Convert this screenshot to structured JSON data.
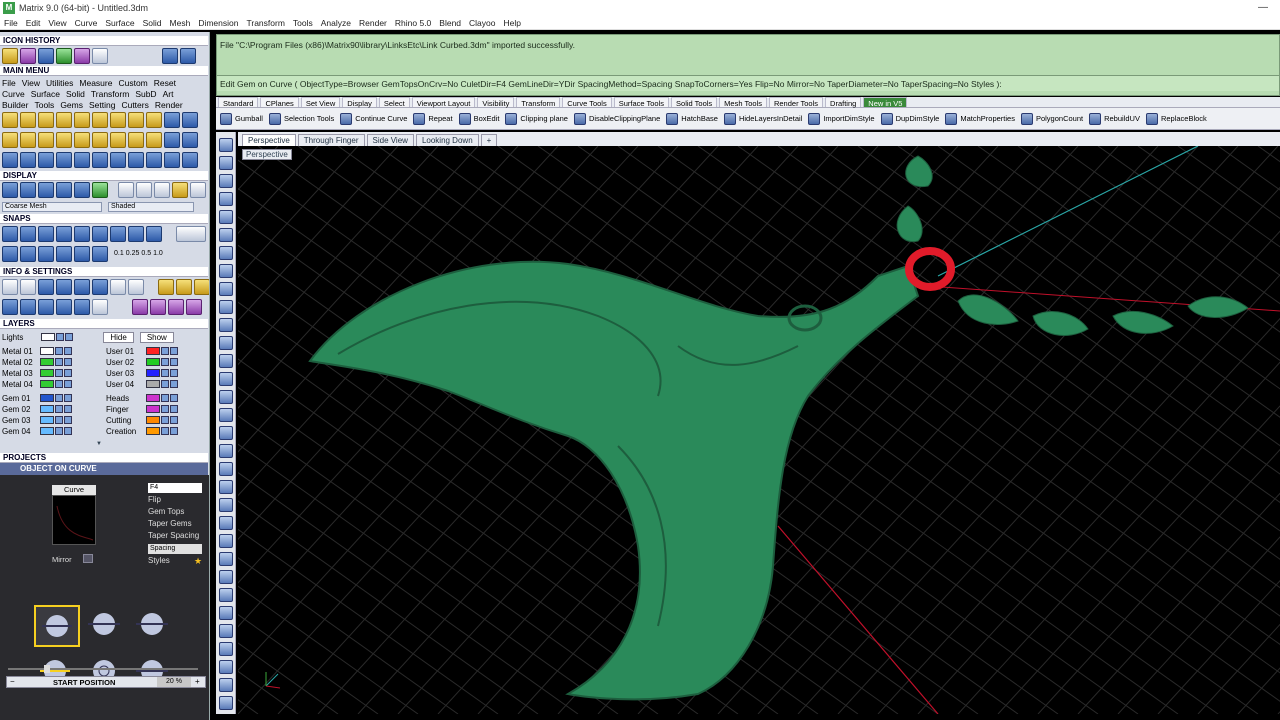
{
  "window": {
    "title": "Matrix 9.0 (64-bit) - Untitled.3dm",
    "logo": "M"
  },
  "menubar": [
    "File",
    "Edit",
    "View",
    "Curve",
    "Surface",
    "Solid",
    "Mesh",
    "Dimension",
    "Transform",
    "Tools",
    "Analyze",
    "Render",
    "Rhino 5.0",
    "Blend",
    "Clayoo",
    "Help"
  ],
  "left": {
    "icon_history": "ICON HISTORY",
    "main_menu": "MAIN MENU",
    "mm_row1": [
      "File",
      "View",
      "Utilities",
      "Measure",
      "Custom",
      "Reset"
    ],
    "mm_row2": [
      "Curve",
      "Surface",
      "Solid",
      "Transform",
      "SubD",
      "Art"
    ],
    "mm_row3": [
      "Builder",
      "Tools",
      "Gems",
      "Setting",
      "Cutters",
      "Render"
    ],
    "display": "DISPLAY",
    "display_sel1": "Coarse Mesh",
    "display_sel2": "Shaded",
    "snaps": "SNAPS",
    "snap_values": [
      "0.1",
      "0.25",
      "0.5",
      "1.0"
    ],
    "info": "INFO & SETTINGS",
    "layers": "LAYERS",
    "layers_lights": "Lights",
    "layers_hide": "Hide",
    "layers_show": "Show",
    "layer_left": [
      "Metal 01",
      "Metal 02",
      "Metal 03",
      "Metal 04",
      "",
      "Gem 01",
      "Gem 02",
      "Gem 03",
      "Gem 04"
    ],
    "layer_right": [
      "User 01",
      "User 02",
      "User 03",
      "User 04",
      "",
      "Heads",
      "Finger",
      "Cutting",
      "Creation"
    ],
    "layer_colors_left": [
      "#ffffff",
      "#33cc33",
      "#33cc33",
      "#33cc33",
      "",
      "#2255cc",
      "#66bbff",
      "#66bbff",
      "#66bbff"
    ],
    "layer_colors_right": [
      "#ff2222",
      "#22cc22",
      "#2222ff",
      "#aaaaaa",
      "",
      "#cc33cc",
      "#cc33cc",
      "#ff8800",
      "#ff9900"
    ],
    "projects": "PROJECTS",
    "object_on_curve": "OBJECT ON CURVE",
    "curve_label": "Curve",
    "mirror_label": "Mirror",
    "props": [
      "F4",
      "Flip",
      "Gem Tops",
      "Taper Gems",
      "Taper Spacing",
      "Spacing",
      "Styles"
    ],
    "start_position": "START POSITION",
    "start_value": "20 %"
  },
  "console": {
    "line1": "File \"C:\\Program Files (x86)\\Matrix90\\library\\LinksEtc\\Link Curbed.3dm\" imported successfully.",
    "prompt": "Edit Gem on Curve ( ObjectType=Browser  GemTopsOnCrv=No  CuletDir=F4  GemLineDir=YDir  SpacingMethod=Spacing  SnapToCorners=Yes  Flip=No  Mirror=No  TaperDiameter=No  TaperSpacing=No  Styles ):"
  },
  "tabs": [
    "Standard",
    "CPlanes",
    "Set View",
    "Display",
    "Select",
    "Viewport Layout",
    "Visibility",
    "Transform",
    "Curve Tools",
    "Surface Tools",
    "Solid Tools",
    "Mesh Tools",
    "Render Tools",
    "Drafting",
    "New in V5"
  ],
  "active_tab": 14,
  "toolbar": [
    "Gumball",
    "Selection Tools",
    "Continue Curve",
    "Repeat",
    "BoxEdit",
    "Clipping plane",
    "DisableClippingPlane",
    "HatchBase",
    "HideLayersInDetail",
    "ImportDimStyle",
    "DupDimStyle",
    "MatchProperties",
    "PolygonCount",
    "RebuildUV",
    "ReplaceBlock"
  ],
  "viewtabs": [
    "Perspective",
    "Through Finger",
    "Side View",
    "Looking Down"
  ],
  "viewport_label": "Perspective",
  "colors": {
    "model": "#2a8a5a",
    "ring": "#e11b2a",
    "axis_green": "#2aa8a8",
    "axis_red": "#c0102a"
  }
}
